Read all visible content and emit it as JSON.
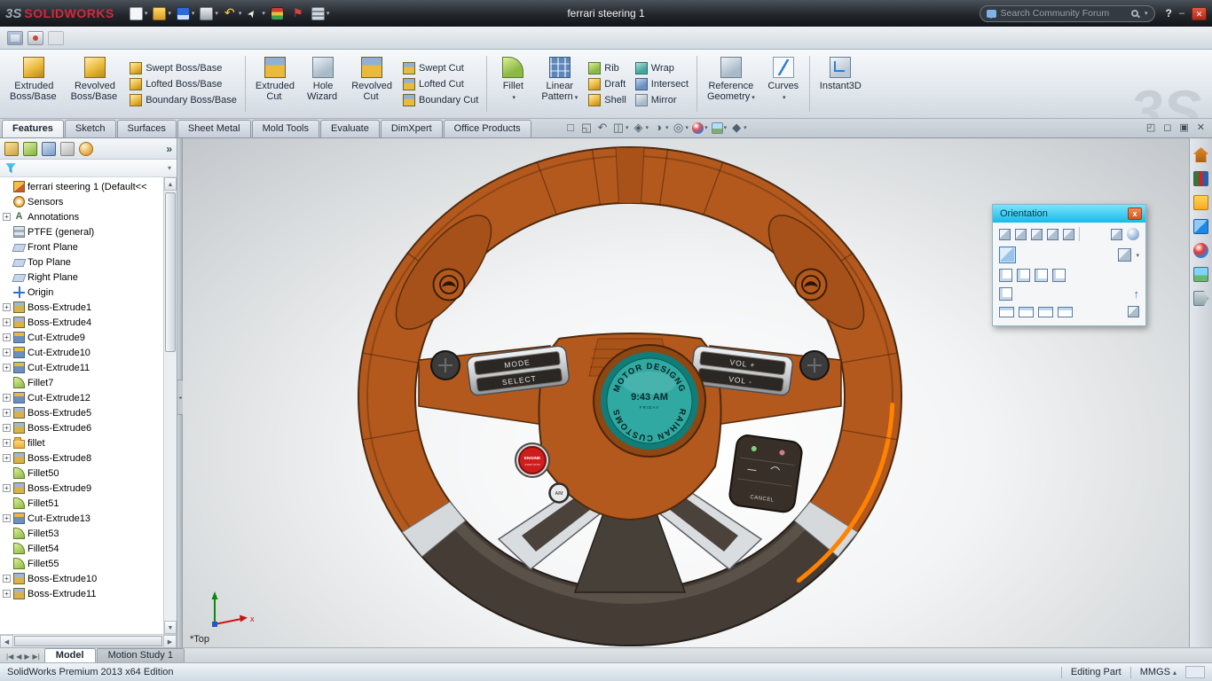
{
  "titlebar": {
    "logo_mark": "3S",
    "logo_text": "SOLIDWORKS",
    "doc_title": "ferrari steering 1",
    "search_placeholder": "Search Community Forum",
    "help": "?",
    "minimize": "–",
    "close": "✕",
    "tools": [
      {
        "name": "new",
        "cls": "m-new",
        "arr": "▾"
      },
      {
        "name": "open",
        "cls": "m-open",
        "arr": "▾"
      },
      {
        "name": "save",
        "cls": "m-save",
        "arr": "▾"
      },
      {
        "name": "print",
        "cls": "m-print",
        "arr": "▾"
      },
      {
        "name": "undo",
        "cls": "m-undo",
        "arr": "▾"
      },
      {
        "name": "select",
        "cls": "m-select",
        "arr": "▾"
      },
      {
        "name": "rebuild",
        "cls": "m-rebuild",
        "arr": ""
      },
      {
        "name": "file-properties",
        "cls": "m-flag",
        "arr": ""
      },
      {
        "name": "options",
        "cls": "m-opts",
        "arr": "▾"
      }
    ]
  },
  "quickbar": [
    {
      "name": "screen-capture",
      "cls": "q-cap"
    },
    {
      "name": "record-video",
      "cls": "q-rec"
    },
    {
      "name": "pause-capture",
      "cls": "q-dis"
    }
  ],
  "watermark": "3S",
  "ribbon": {
    "g1_large": [
      {
        "l1": "Extruded",
        "l2": "Boss/Base",
        "arrow": "",
        "icon": "i-gold"
      },
      {
        "l1": "Revolved",
        "l2": "Boss/Base",
        "arrow": "",
        "icon": "i-gold"
      }
    ],
    "g1_stack": [
      {
        "label": "Swept Boss/Base",
        "icon": "i-gold"
      },
      {
        "label": "Lofted Boss/Base",
        "icon": "i-gold"
      },
      {
        "label": "Boundary Boss/Base",
        "icon": "i-gold"
      }
    ],
    "g2_large": [
      {
        "l1": "Extruded",
        "l2": "Cut",
        "arrow": "",
        "icon": "i-goldblue"
      },
      {
        "l1": "Hole",
        "l2": "Wizard",
        "arrow": "",
        "icon": "i-grayblue"
      },
      {
        "l1": "Revolved",
        "l2": "Cut",
        "arrow": "",
        "icon": "i-goldblue"
      }
    ],
    "g2_stack": [
      {
        "label": "Swept Cut",
        "icon": "i-goldblue"
      },
      {
        "label": "Lofted Cut",
        "icon": "i-goldblue"
      },
      {
        "label": "Boundary Cut",
        "icon": "i-goldblue"
      }
    ],
    "g3_large": [
      {
        "l1": "Fillet",
        "l2": "",
        "arrow": "▾",
        "icon": "i-fillet"
      },
      {
        "l1": "Linear",
        "l2": "Pattern",
        "arrow": "▾",
        "icon": "i-pattern"
      }
    ],
    "g3_stack1": [
      {
        "label": "Rib",
        "icon": "i-green"
      },
      {
        "label": "Draft",
        "icon": "i-gold"
      },
      {
        "label": "Shell",
        "icon": "i-gold"
      }
    ],
    "g3_stack2": [
      {
        "label": "Wrap",
        "icon": "i-teal"
      },
      {
        "label": "Intersect",
        "icon": "i-blue"
      },
      {
        "label": "Mirror",
        "icon": "i-grayblue"
      }
    ],
    "g4_large": [
      {
        "l1": "Reference",
        "l2": "Geometry",
        "arrow": "▾",
        "icon": "i-grayblue"
      },
      {
        "l1": "Curves",
        "l2": "",
        "arrow": "▾",
        "icon": "i-curve"
      }
    ],
    "g5_large": [
      {
        "l1": "Instant3D",
        "l2": "",
        "arrow": "",
        "icon": "i-inst"
      }
    ]
  },
  "tabs": [
    "Features",
    "Sketch",
    "Surfaces",
    "Sheet Metal",
    "Mold Tools",
    "Evaluate",
    "DimXpert",
    "Office Products"
  ],
  "hud": [
    {
      "name": "zoom-fit",
      "glyph": "□",
      "cls": "",
      "arr": ""
    },
    {
      "name": "zoom-area",
      "glyph": "◱",
      "cls": "",
      "arr": ""
    },
    {
      "name": "previous-view",
      "glyph": "↶",
      "cls": "",
      "arr": ""
    },
    {
      "name": "section-view",
      "glyph": "◫",
      "cls": "",
      "arr": "▾"
    },
    {
      "name": "view-orientation",
      "glyph": "◈",
      "cls": "",
      "arr": "▾"
    },
    {
      "name": "display-style",
      "glyph": "◑",
      "cls": "",
      "arr": "▾"
    },
    {
      "name": "hide-show-items",
      "glyph": "◎",
      "cls": "",
      "arr": "▾"
    },
    {
      "name": "edit-appearance",
      "glyph": "",
      "cls": "h-ball",
      "arr": "▾"
    },
    {
      "name": "apply-scene",
      "glyph": "",
      "cls": "h-scene",
      "arr": "▾"
    },
    {
      "name": "view-settings",
      "glyph": "◆",
      "cls": "",
      "arr": "▾"
    }
  ],
  "winctl": [
    {
      "name": "pane-toggle",
      "g": "◰"
    },
    {
      "name": "restore",
      "g": "◻"
    },
    {
      "name": "maximize",
      "g": "▣"
    },
    {
      "name": "close-document",
      "g": "✕"
    }
  ],
  "fm": {
    "chevron": "»",
    "filter_arrow": "▾"
  },
  "scroll": {
    "up": "▲",
    "down": "▼",
    "left": "◀",
    "right": "▶"
  },
  "splitter_glyph": "◂",
  "tree": {
    "root": {
      "label": "ferrari steering 1 (Default<<",
      "icon": "t-part"
    },
    "items": [
      {
        "label": "Sensors",
        "icon": "t-sensors",
        "exp": ""
      },
      {
        "label": "Annotations",
        "icon": "t-annot",
        "exp": "+"
      },
      {
        "label": "PTFE (general)",
        "icon": "t-material",
        "exp": ""
      },
      {
        "label": "Front Plane",
        "icon": "t-plane",
        "exp": ""
      },
      {
        "label": "Top Plane",
        "icon": "t-plane",
        "exp": ""
      },
      {
        "label": "Right Plane",
        "icon": "t-plane",
        "exp": ""
      },
      {
        "label": "Origin",
        "icon": "t-origin",
        "exp": ""
      },
      {
        "label": "Boss-Extrude1",
        "icon": "t-boss",
        "exp": "+"
      },
      {
        "label": "Boss-Extrude4",
        "icon": "t-boss",
        "exp": "+"
      },
      {
        "label": "Cut-Extrude9",
        "icon": "t-cut",
        "exp": "+"
      },
      {
        "label": "Cut-Extrude10",
        "icon": "t-cut",
        "exp": "+"
      },
      {
        "label": "Cut-Extrude11",
        "icon": "t-cut",
        "exp": "+"
      },
      {
        "label": "Fillet7",
        "icon": "t-fillet",
        "exp": ""
      },
      {
        "label": "Cut-Extrude12",
        "icon": "t-cut",
        "exp": "+"
      },
      {
        "label": "Boss-Extrude5",
        "icon": "t-boss",
        "exp": "+"
      },
      {
        "label": "Boss-Extrude6",
        "icon": "t-boss",
        "exp": "+"
      },
      {
        "label": "fillet",
        "icon": "t-folder",
        "exp": "+"
      },
      {
        "label": "Boss-Extrude8",
        "icon": "t-boss",
        "exp": "+"
      },
      {
        "label": "Fillet50",
        "icon": "t-fillet",
        "exp": ""
      },
      {
        "label": "Boss-Extrude9",
        "icon": "t-boss",
        "exp": "+"
      },
      {
        "label": "Fillet51",
        "icon": "t-fillet",
        "exp": ""
      },
      {
        "label": "Cut-Extrude13",
        "icon": "t-cut",
        "exp": "+"
      },
      {
        "label": "Fillet53",
        "icon": "t-fillet",
        "exp": ""
      },
      {
        "label": "Fillet54",
        "icon": "t-fillet",
        "exp": ""
      },
      {
        "label": "Fillet55",
        "icon": "t-fillet",
        "exp": ""
      },
      {
        "label": "Boss-Extrude10",
        "icon": "t-boss",
        "exp": "+"
      },
      {
        "label": "Boss-Extrude11",
        "icon": "t-boss",
        "exp": "+"
      }
    ]
  },
  "orientation": {
    "title": "Orientation",
    "close": "x",
    "up_arrow": "↑",
    "selector_arrow": "▾"
  },
  "taskpane": [
    {
      "name": "solidworks-resources",
      "cls": "tp-home"
    },
    {
      "name": "design-library",
      "cls": "tp-lib"
    },
    {
      "name": "file-explorer",
      "cls": "tp-files"
    },
    {
      "name": "view-palette",
      "cls": "tp-palette"
    },
    {
      "name": "appearances-scenes",
      "cls": "tp-appear"
    },
    {
      "name": "decals",
      "cls": "tp-scene"
    },
    {
      "name": "custom-properties",
      "cls": "tp-props"
    }
  ],
  "wheel": {
    "badge_top": "MOTOR DESIGNG",
    "badge_time": "9:43 AM",
    "badge_day": "FRIDAY",
    "badge_bottom": "RAIHAN CUSTOMS",
    "mode": "MODE",
    "select": "SELECT",
    "vol_up": "VOL +",
    "vol_down": "VOL -",
    "engine": "ENGINE",
    "engine_sub": "START STOP",
    "am": "A/M",
    "cancel": "CANCEL",
    "triad_view": "*Top",
    "triad_x": "x"
  },
  "bottom": {
    "nav": [
      "|◀",
      "◀",
      "▶",
      "▶|"
    ],
    "tabs": [
      {
        "label": "Model",
        "cls": "active"
      },
      {
        "label": "Motion Study 1",
        "cls": ""
      }
    ]
  },
  "statusbar": {
    "edition": "SolidWorks Premium 2013 x64 Edition",
    "mode": "Editing Part",
    "units": "MMGS",
    "units_caret": "▴"
  },
  "colors": {
    "rim_brown": "#b4591d",
    "grip_dark": "#453c35",
    "accent_orange": "#ff8200",
    "badge_teal": "#2fa9a2",
    "engine_red": "#cf1d1d",
    "orientation_titlebar": "#17b9ea"
  }
}
